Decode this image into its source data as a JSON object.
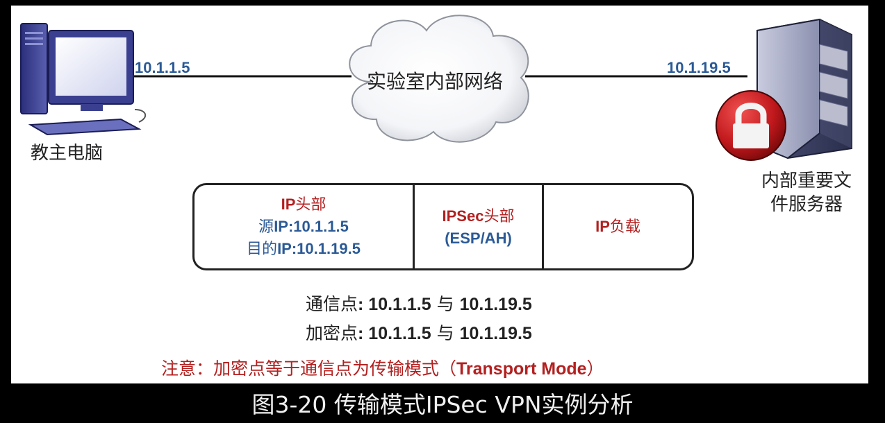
{
  "left_node": {
    "ip": "10.1.1.5",
    "label": "教主电脑"
  },
  "cloud": {
    "label": "实验室内部网络"
  },
  "right_node": {
    "ip": "10.1.19.5",
    "label_line1": "内部重要文",
    "label_line2": "件服务器"
  },
  "packet": {
    "ip_header": {
      "title_bold": "IP",
      "title_rest": "头部",
      "src_prefix": "源",
      "src_value": "IP:10.1.1.5",
      "dst_prefix": "目的",
      "dst_value": "IP:10.1.19.5"
    },
    "ipsec_header": {
      "title_bold": "IPSec",
      "title_rest": "头部",
      "sub": "(ESP/AH)"
    },
    "payload": {
      "title_bold": "IP",
      "title_rest": "负载"
    }
  },
  "comm_points": {
    "label": "通信点",
    "value": ": 10.1.1.5",
    "sep": " 与 ",
    "value2": "10.1.19.5"
  },
  "crypto_points": {
    "label": "加密点",
    "value": ": 10.1.1.5",
    "sep": " 与 ",
    "value2": "10.1.19.5"
  },
  "note": {
    "text": "注意：加密点等于通信点为传输模式（",
    "bold": "Transport Mode",
    "close": "）"
  },
  "caption": "图3-20 传输模式IPSec VPN实例分析",
  "colors": {
    "ip_blue": "#2b5a96",
    "accent_red": "#b32020",
    "lock_red": "#c0181c"
  }
}
